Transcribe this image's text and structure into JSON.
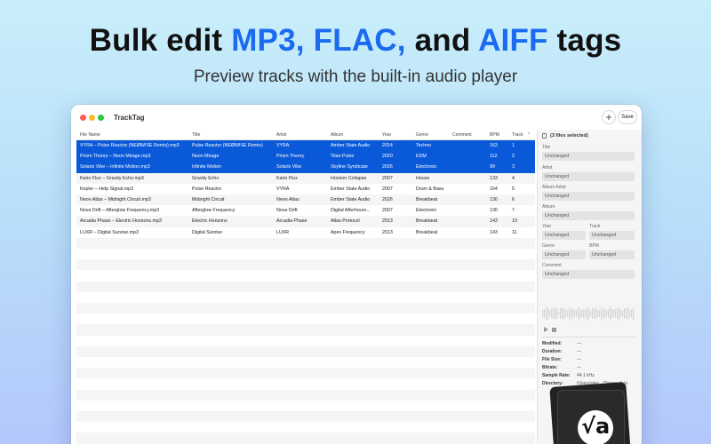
{
  "headline": {
    "part1": "Bulk edit ",
    "accent1": "MP3,",
    "part2": " ",
    "accent2": "FLAC,",
    "part3": " and ",
    "accent3": "AIFF",
    "part4": " tags"
  },
  "subline": "Preview tracks with the built-in audio player",
  "colors": {
    "accent": "#1b6bf0",
    "selection": "#0a59d9"
  },
  "window": {
    "title": "TrackTag",
    "add_label": "+",
    "save_label": "Save"
  },
  "table": {
    "columns": [
      "File Name",
      "Title",
      "Artist",
      "Album",
      "Year",
      "Genre",
      "Comment",
      "BPM",
      "Track"
    ],
    "sort_indicator": "⌃",
    "rows": [
      {
        "file": "VYRA – Pulse Reactor (NEØWISE Remix).mp3",
        "title": "Pulse Reactor (NEØWISE Remix)",
        "artist": "VYRA",
        "album": "Amber State Audio",
        "year": "2014",
        "genre": "Techno",
        "comment": "",
        "bpm": "163",
        "track": "1",
        "selected": true
      },
      {
        "file": "Prism Theory – Neon Mirage.mp3",
        "title": "Neon Mirage",
        "artist": "Prism Theory",
        "album": "Titan Pulse",
        "year": "2020",
        "genre": "EDM",
        "comment": "",
        "bpm": "112",
        "track": "2",
        "selected": true
      },
      {
        "file": "Solaris Vibe – Infinite Motion.mp3",
        "title": "Infinite Motion",
        "artist": "Solaris Vibe",
        "album": "Skyline Syndicate",
        "year": "2026",
        "genre": "Electronic",
        "comment": "",
        "bpm": "99",
        "track": "3",
        "selected": true
      },
      {
        "file": "Kairo Flux – Gravity Echo.mp3",
        "title": "Gravity Echo",
        "artist": "Kairo Flux",
        "album": "Horizon Collapse",
        "year": "2007",
        "genre": "House",
        "comment": "",
        "bpm": "133",
        "track": "4",
        "selected": false
      },
      {
        "file": "Kepler – Help Signal.mp3",
        "title": "Pulse Reactor",
        "artist": "VYRA",
        "album": "Ember State Audio",
        "year": "2007",
        "genre": "Drum & Bass",
        "comment": "",
        "bpm": "164",
        "track": "5",
        "selected": false
      },
      {
        "file": "Neon Atlas – Midnight Circuit.mp3",
        "title": "Midnight Circuit",
        "artist": "Neon Atlas",
        "album": "Ember State Audio",
        "year": "2026",
        "genre": "Breakbeat",
        "comment": "",
        "bpm": "130",
        "track": "6",
        "selected": false
      },
      {
        "file": "Nova Drift – Afterglow Frequency.mp3",
        "title": "Afterglow Frequency",
        "artist": "Nova Drift",
        "album": "Digital Afterhours...",
        "year": "2007",
        "genre": "Electronic",
        "comment": "",
        "bpm": "130",
        "track": "7",
        "selected": false
      },
      {
        "file": "Arcadia Phase – Electric Horizons.mp3",
        "title": "Electric Horizons",
        "artist": "Arcadia Phase",
        "album": "Atlas Protocol",
        "year": "2013",
        "genre": "Breakbeat",
        "comment": "",
        "bpm": "143",
        "track": "10",
        "selected": false
      },
      {
        "file": "LUXR – Digital Sunrise.mp3",
        "title": "Digital Sunrise",
        "artist": "LUXR",
        "album": "Apex Frequency",
        "year": "2013",
        "genre": "Breakbeat",
        "comment": "",
        "bpm": "143",
        "track": "11",
        "selected": false
      }
    ]
  },
  "inspector": {
    "selection_count": "(3 files selected)",
    "fields": [
      {
        "label": "Title",
        "value": "Unchanged"
      },
      {
        "label": "Artist",
        "value": "Unchanged"
      },
      {
        "label": "Album Artist",
        "value": "Unchanged"
      },
      {
        "label": "Album",
        "value": "Unchanged"
      },
      {
        "label": "Year",
        "value": "Unchanged"
      },
      {
        "label": "Track",
        "value": "Unchanged"
      },
      {
        "label": "Genre",
        "value": "Unchanged"
      },
      {
        "label": "BPM",
        "value": "Unchanged"
      },
      {
        "label": "Comment",
        "value": "Unchanged"
      }
    ],
    "meta": [
      {
        "label": "Modified:",
        "value": "—"
      },
      {
        "label": "Duration:",
        "value": "—"
      },
      {
        "label": "File Size:",
        "value": "—"
      },
      {
        "label": "Bitrate:",
        "value": "—"
      },
      {
        "label": "Sample Rate:",
        "value": "44.1 kHz"
      },
      {
        "label": "Directory:",
        "value": "/Users/alex.../Tagger data"
      }
    ],
    "artwork_glyph": "√a"
  }
}
